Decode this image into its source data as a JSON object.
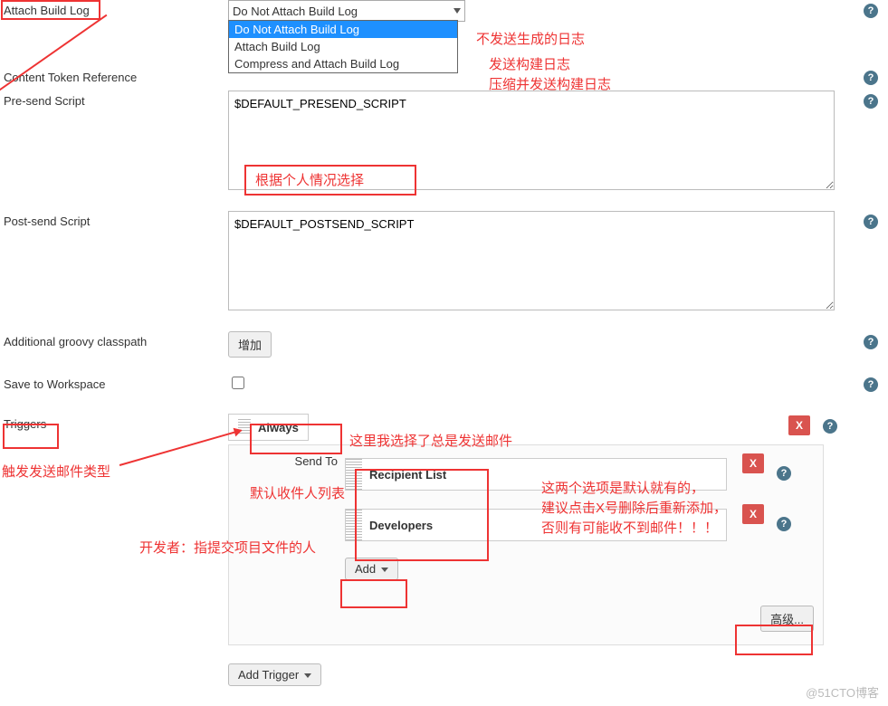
{
  "labels": {
    "attach_build_log": "Attach Build Log",
    "content_token_ref": "Content Token Reference",
    "pre_send": "Pre-send Script",
    "post_send": "Post-send Script",
    "groovy_cp": "Additional groovy classpath",
    "save_ws": "Save to Workspace",
    "triggers": "Triggers"
  },
  "attach_select": {
    "selected": "Do Not Attach Build Log",
    "options": [
      "Do Not Attach Build Log",
      "Attach Build Log",
      "Compress and Attach Build Log"
    ]
  },
  "pre_send_value": "$DEFAULT_PRESEND_SCRIPT",
  "post_send_value": "$DEFAULT_POSTSEND_SCRIPT",
  "buttons": {
    "add_cp": "增加",
    "add": "Add",
    "advanced": "高级...",
    "add_trigger": "Add Trigger",
    "x": "X"
  },
  "trigger": {
    "always": "Always",
    "send_to": "Send To",
    "recipients": [
      "Recipient List",
      "Developers"
    ]
  },
  "annotations": {
    "opt1": "不发送生成的日志",
    "opt2": "发送构建日志",
    "opt3": "压缩并发送构建日志",
    "choose": "根据个人情况选择",
    "always_note": "这里我选择了总是发送邮件",
    "trigger_type": "触发发送邮件类型",
    "default_recip": "默认收件人列表",
    "dev_note": "开发者：指提交项目文件的人",
    "two_opts_l1": "这两个选项是默认就有的，",
    "two_opts_l2": "建议点击X号删除后重新添加，",
    "two_opts_l3": "否则有可能收不到邮件！！！"
  },
  "watermark": "@51CTO博客"
}
